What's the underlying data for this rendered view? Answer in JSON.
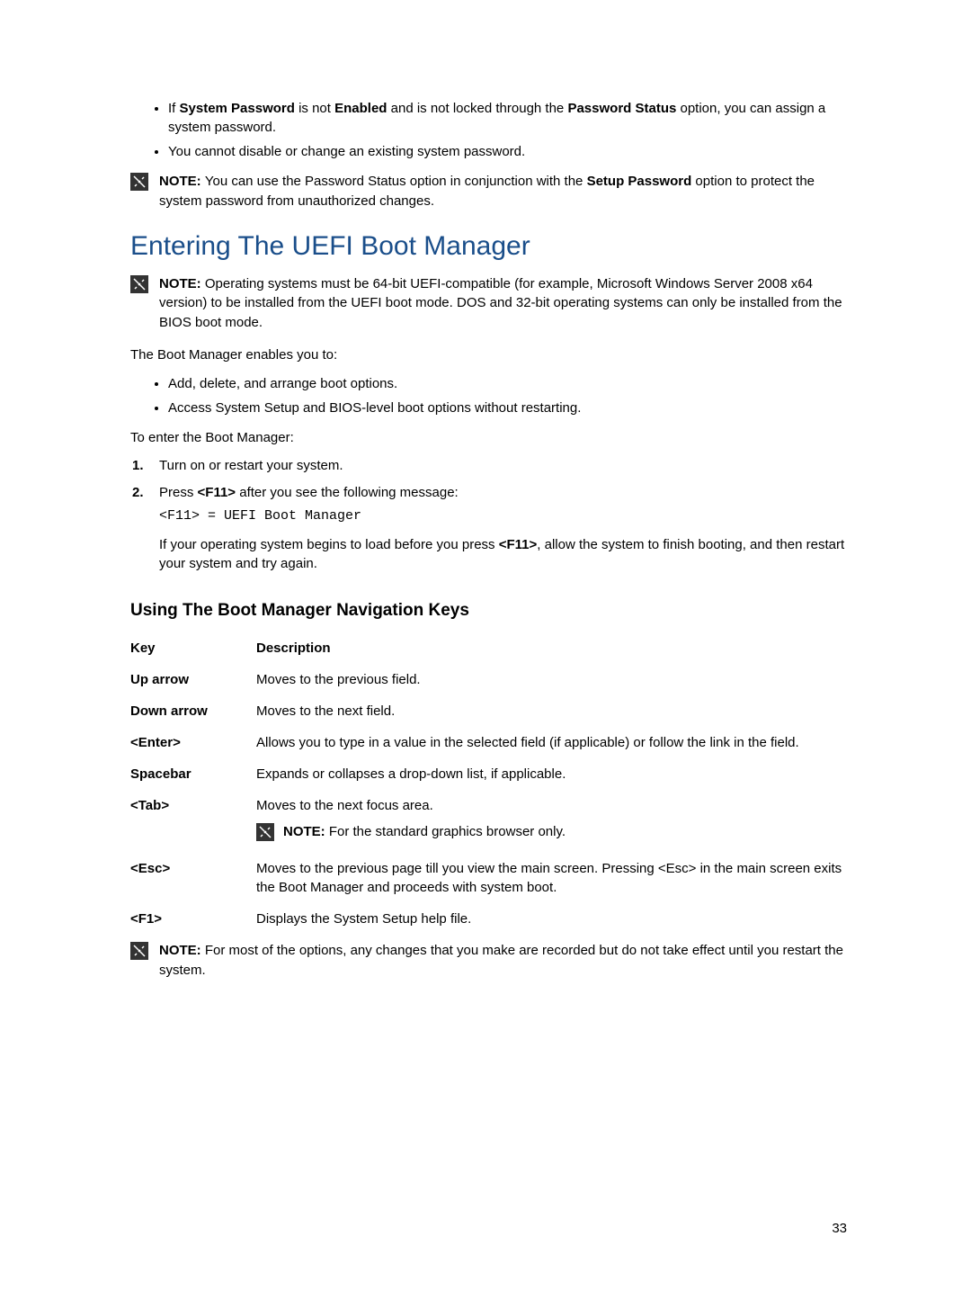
{
  "intro": {
    "bullets": [
      {
        "prefix": "If ",
        "b1": "System Password",
        "mid1": " is not ",
        "b2": "Enabled",
        "mid2": " and is not locked through the ",
        "b3": "Password Status",
        "suffix": " option, you can assign a system password."
      },
      {
        "text": "You cannot disable or change an existing system password."
      }
    ],
    "note": {
      "label": "NOTE: ",
      "pre": "You can use the Password Status option in conjunction with the ",
      "b1": "Setup Password",
      "post": " option to protect the system password from unauthorized changes."
    }
  },
  "section": {
    "title": "Entering The UEFI Boot Manager",
    "note": {
      "label": "NOTE: ",
      "text": "Operating systems must be 64-bit UEFI-compatible (for example, Microsoft Windows Server 2008 x64 version) to be installed from the UEFI boot mode. DOS and 32-bit operating systems can only be installed from the BIOS boot mode."
    },
    "p1": "The Boot Manager enables you to:",
    "bullets": [
      "Add, delete, and arrange boot options.",
      "Access System Setup and BIOS-level boot options without restarting."
    ],
    "p2": "To enter the Boot Manager:",
    "steps": [
      {
        "num": "1.",
        "text": "Turn on or restart your system."
      },
      {
        "num": "2.",
        "pre": "Press ",
        "b1": "<F11>",
        "post": " after you see the following message:",
        "code": "<F11> = UEFI Boot Manager",
        "para_pre": "If your operating system begins to load before you press ",
        "para_b1": "<F11>",
        "para_post": ", allow the system to finish booting, and then restart your system and try again."
      }
    ]
  },
  "subsection": {
    "title": "Using The Boot Manager Navigation Keys",
    "header": {
      "key": "Key",
      "desc": "Description"
    },
    "rows": [
      {
        "key": "Up arrow",
        "desc": "Moves to the previous field."
      },
      {
        "key": "Down arrow",
        "desc": "Moves to the next field."
      },
      {
        "key": "<Enter>",
        "desc": "Allows you to type in a value in the selected field (if applicable) or follow the link in the field."
      },
      {
        "key": "Spacebar",
        "desc": "Expands or collapses a drop-down list, if applicable."
      },
      {
        "key": "<Tab>",
        "desc": "Moves to the next focus area.",
        "note_label": "NOTE: ",
        "note_text": "For the standard graphics browser only."
      },
      {
        "key": "<Esc>",
        "desc": "Moves to the previous page till you view the main screen. Pressing <Esc> in the main screen exits the Boot Manager and proceeds with system boot."
      },
      {
        "key": "<F1>",
        "desc": "Displays the System Setup help file."
      }
    ],
    "end_note": {
      "label": "NOTE: ",
      "text": "For most of the options, any changes that you make are recorded but do not take effect until you restart the system."
    }
  },
  "page_number": "33"
}
